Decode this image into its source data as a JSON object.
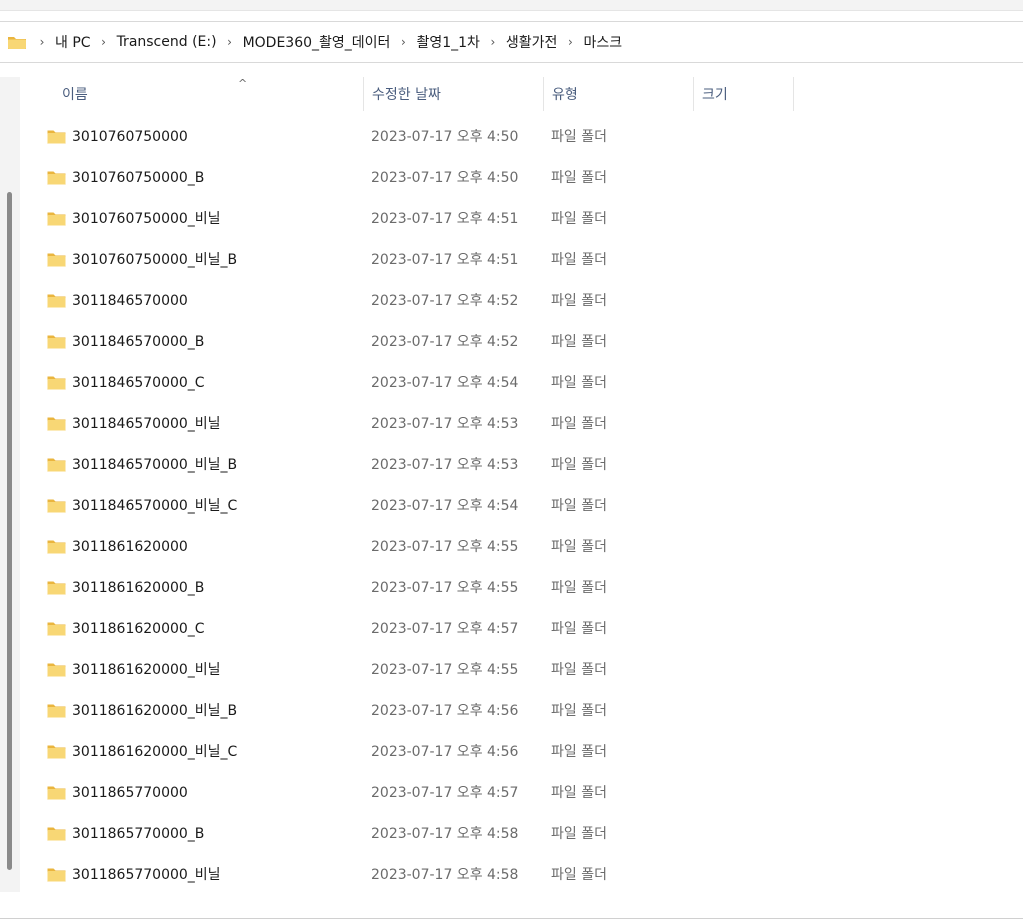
{
  "address": {
    "icon": "folder-icon",
    "breadcrumbs": [
      "내 PC",
      "Transcend (E:)",
      "MODE360_촬영_데이터",
      "촬영1_1차",
      "생활가전",
      "마스크"
    ],
    "separator": "›"
  },
  "columns": {
    "name": "이름",
    "date": "수정한 날짜",
    "type": "유형",
    "size": "크기",
    "sort_indicator": "^"
  },
  "files": [
    {
      "name": "3010760750000",
      "date": "2023-07-17 오후 4:50",
      "type": "파일 폴더"
    },
    {
      "name": "3010760750000_B",
      "date": "2023-07-17 오후 4:50",
      "type": "파일 폴더"
    },
    {
      "name": "3010760750000_비닐",
      "date": "2023-07-17 오후 4:51",
      "type": "파일 폴더"
    },
    {
      "name": "3010760750000_비닐_B",
      "date": "2023-07-17 오후 4:51",
      "type": "파일 폴더"
    },
    {
      "name": "3011846570000",
      "date": "2023-07-17 오후 4:52",
      "type": "파일 폴더"
    },
    {
      "name": "3011846570000_B",
      "date": "2023-07-17 오후 4:52",
      "type": "파일 폴더"
    },
    {
      "name": "3011846570000_C",
      "date": "2023-07-17 오후 4:54",
      "type": "파일 폴더"
    },
    {
      "name": "3011846570000_비닐",
      "date": "2023-07-17 오후 4:53",
      "type": "파일 폴더"
    },
    {
      "name": "3011846570000_비닐_B",
      "date": "2023-07-17 오후 4:53",
      "type": "파일 폴더"
    },
    {
      "name": "3011846570000_비닐_C",
      "date": "2023-07-17 오후 4:54",
      "type": "파일 폴더"
    },
    {
      "name": "3011861620000",
      "date": "2023-07-17 오후 4:55",
      "type": "파일 폴더"
    },
    {
      "name": "3011861620000_B",
      "date": "2023-07-17 오후 4:55",
      "type": "파일 폴더"
    },
    {
      "name": "3011861620000_C",
      "date": "2023-07-17 오후 4:57",
      "type": "파일 폴더"
    },
    {
      "name": "3011861620000_비닐",
      "date": "2023-07-17 오후 4:55",
      "type": "파일 폴더"
    },
    {
      "name": "3011861620000_비닐_B",
      "date": "2023-07-17 오후 4:56",
      "type": "파일 폴더"
    },
    {
      "name": "3011861620000_비닐_C",
      "date": "2023-07-17 오후 4:56",
      "type": "파일 폴더"
    },
    {
      "name": "3011865770000",
      "date": "2023-07-17 오후 4:57",
      "type": "파일 폴더"
    },
    {
      "name": "3011865770000_B",
      "date": "2023-07-17 오후 4:58",
      "type": "파일 폴더"
    },
    {
      "name": "3011865770000_비닐",
      "date": "2023-07-17 오후 4:58",
      "type": "파일 폴더"
    }
  ],
  "colors": {
    "folder_body": "#f8d775",
    "folder_tab": "#eab53e",
    "header_text": "#4a5d7e",
    "secondary_text": "#6b6b6b"
  }
}
